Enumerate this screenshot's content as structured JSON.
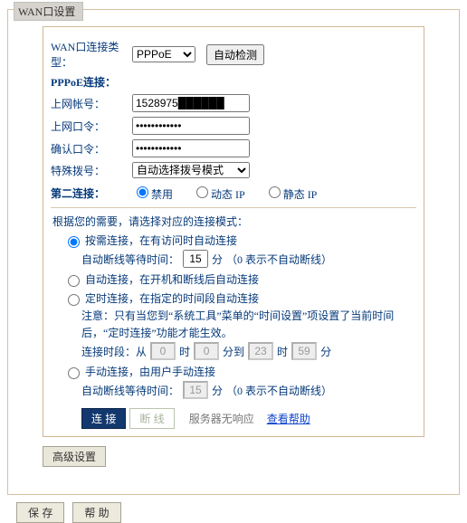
{
  "panel": {
    "title": "WAN口设置"
  },
  "labels": {
    "conn_type": "WAN口连接类型：",
    "pppoe_section": "PPPoE连接：",
    "account": "上网帐号：",
    "password": "上网口令：",
    "confirm": "确认口令：",
    "special_dial": "特殊拨号：",
    "second_conn": "第二连接："
  },
  "fields": {
    "conn_type": "PPPoE",
    "account": "1528975██████",
    "password": "••••••••••••",
    "confirm": "••••••••••••",
    "special_dial": "自动选择拨号模式"
  },
  "second_conn": {
    "disabled": "禁用",
    "dynamic": "动态 IP",
    "static_ip": "静态 IP"
  },
  "mode": {
    "hint": "根据您的需要，请选择对应的连接模式：",
    "demand": "按需连接，在有访问时自动连接",
    "auto": "自动连接，在开机和断线后自动连接",
    "timed": "定时连接，在指定的时间段自动连接",
    "timed_note": "注意：只有当您到“系统工具”菜单的“时间设置”项设置了当前时间后，“定时连接”功能才能生效。",
    "manual": "手动连接，由用户手动连接",
    "idle_label": "自动断线等待时间：",
    "idle_unit": "分",
    "idle_note": "（0 表示不自动断线）",
    "idle_time1": "15",
    "idle_time2": "15",
    "period_label": "连接时段：从",
    "from_h": "0",
    "from_m": "0",
    "to_h": "23",
    "to_m": "59",
    "unit_h": "时",
    "unit_m": "分",
    "unit_m_to": "分到"
  },
  "status": {
    "no_response": "服务器无响应",
    "help_link": "查看帮助"
  },
  "buttons": {
    "auto_detect": "自动检测",
    "connect": "连 接",
    "disconnect": "断 线",
    "advanced": "高级设置",
    "save": "保 存",
    "help": "帮 助"
  }
}
